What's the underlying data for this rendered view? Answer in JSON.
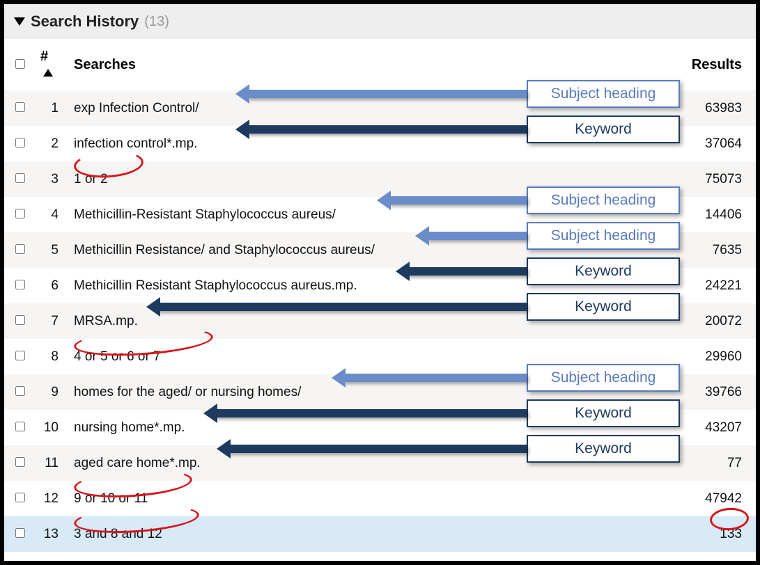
{
  "header": {
    "title": "Search History",
    "count_display": "(13)"
  },
  "columns": {
    "num": "#",
    "searches": "Searches",
    "results": "Results"
  },
  "rows": [
    {
      "num": "1",
      "query": "exp Infection Control/",
      "results": "63983",
      "annotation": "subject"
    },
    {
      "num": "2",
      "query": "infection control*.mp.",
      "results": "37064",
      "annotation": "keyword"
    },
    {
      "num": "3",
      "query": "1 or 2",
      "results": "75073",
      "circle": true
    },
    {
      "num": "4",
      "query": "Methicillin-Resistant Staphylococcus aureus/",
      "results": "14406",
      "annotation": "subject"
    },
    {
      "num": "5",
      "query": "Methicillin Resistance/ and Staphylococcus aureus/",
      "results": "7635",
      "annotation": "subject"
    },
    {
      "num": "6",
      "query": "Methicillin Resistant Staphylococcus aureus.mp.",
      "results": "24221",
      "annotation": "keyword"
    },
    {
      "num": "7",
      "query": "MRSA.mp.",
      "results": "20072",
      "annotation": "keyword"
    },
    {
      "num": "8",
      "query": "4 or 5 or 6 or 7",
      "results": "29960",
      "circle": true
    },
    {
      "num": "9",
      "query": "homes for the aged/ or nursing homes/",
      "results": "39766",
      "annotation": "subject"
    },
    {
      "num": "10",
      "query": "nursing home*.mp.",
      "results": "43207",
      "annotation": "keyword"
    },
    {
      "num": "11",
      "query": "aged care home*.mp.",
      "results": "77",
      "annotation": "keyword"
    },
    {
      "num": "12",
      "query": "9 or 10 or 11",
      "results": "47942",
      "circle": true
    },
    {
      "num": "13",
      "query": "3 and 8 and 12",
      "results": "133",
      "circle": true,
      "circle_result": true,
      "highlight": true
    }
  ],
  "labels": {
    "subject": "Subject heading",
    "keyword": "Keyword"
  }
}
